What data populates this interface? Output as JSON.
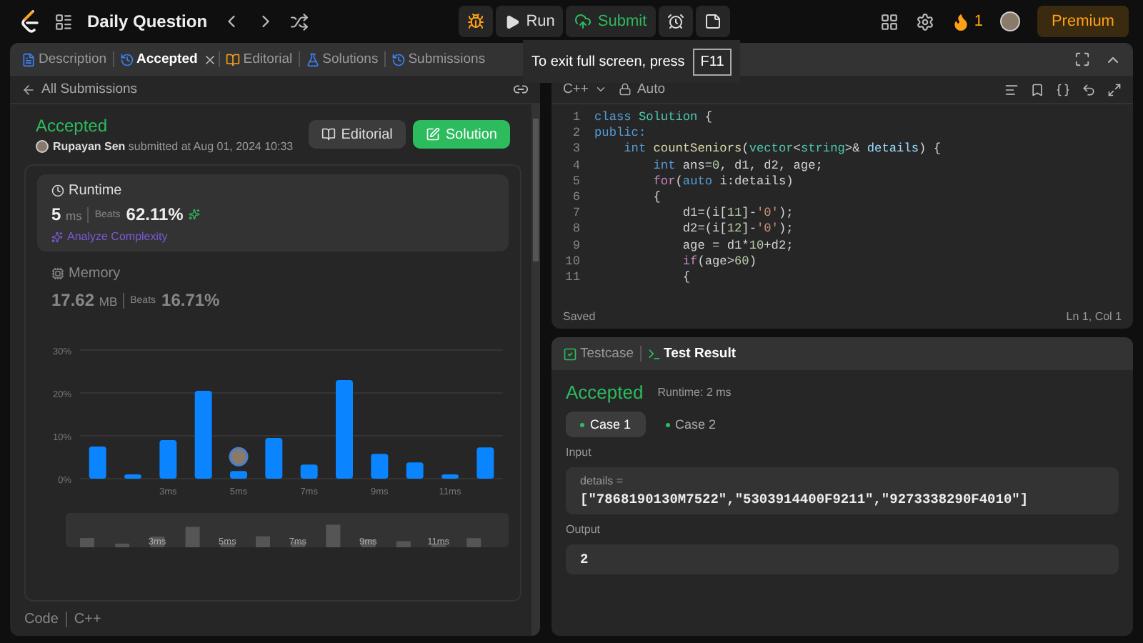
{
  "top_bar": {
    "title": "Daily Question",
    "run": "Run",
    "submit": "Submit",
    "streak": "1",
    "premium": "Premium"
  },
  "fullscreen_tip": {
    "text": "To exit full screen, press",
    "key": "F11"
  },
  "left_tabs": [
    {
      "label": "Description",
      "selected": false,
      "closable": false
    },
    {
      "label": "Accepted",
      "selected": true,
      "closable": true
    },
    {
      "label": "Editorial",
      "selected": false,
      "closable": false
    },
    {
      "label": "Solutions",
      "selected": false,
      "closable": false
    },
    {
      "label": "Submissions",
      "selected": false,
      "closable": false
    }
  ],
  "submission": {
    "back": "All Submissions",
    "status": "Accepted",
    "user": "Rupayan Sen",
    "submitted": "submitted at Aug 01, 2024 10:33",
    "editorial_button": "Editorial",
    "solution_button": "Solution",
    "runtime": {
      "title": "Runtime",
      "value": "5",
      "unit": "ms",
      "beats_label": "Beats",
      "beats": "62.11%",
      "analyze": "Analyze Complexity"
    },
    "memory": {
      "title": "Memory",
      "value": "17.62",
      "unit": "MB",
      "beats_label": "Beats",
      "beats": "16.71%"
    },
    "chart_data": {
      "type": "bar",
      "x": [
        1,
        2,
        3,
        4,
        5,
        6,
        7,
        8,
        9,
        10,
        11,
        12
      ],
      "series": [
        {
          "color": "#0a84ff",
          "values": [
            7.5,
            1,
            9,
            20.5,
            1.8,
            9.5,
            3.3,
            23,
            5.8,
            3.8,
            1,
            7.3
          ]
        }
      ],
      "xlim": [
        0.5,
        12.5
      ],
      "ylim": [
        0,
        30
      ],
      "yticks": [
        {
          "value": 0,
          "label": "0%"
        },
        {
          "value": 10,
          "label": "10%"
        },
        {
          "value": 20,
          "label": "20%"
        },
        {
          "value": 30,
          "label": "30%"
        }
      ],
      "xticks": [
        {
          "value": 3,
          "label": "3ms"
        },
        {
          "value": 5,
          "label": "5ms"
        },
        {
          "value": 7,
          "label": "7ms"
        },
        {
          "value": 9,
          "label": "9ms"
        },
        {
          "value": 11,
          "label": "11ms"
        }
      ]
    },
    "brush_labels": [
      "3ms",
      "5ms",
      "7ms",
      "9ms",
      "11ms"
    ],
    "code_label": "Code",
    "code_language": "C++"
  },
  "editor": {
    "language": "C++",
    "mode": "Auto",
    "status": "Saved",
    "position": "Ln 1, Col 1",
    "lines": [
      {
        "number": "1",
        "tokens": [
          {
            "kind": "kw",
            "text": "class"
          },
          {
            "kind": "type",
            "text": " Solution"
          },
          {
            "kind": "plain",
            "text": " {"
          }
        ]
      },
      {
        "number": "2",
        "tokens": [
          {
            "kind": "kw",
            "text": "public:"
          }
        ]
      },
      {
        "number": "3",
        "tokens": [
          {
            "kind": "kw",
            "text": "    int"
          },
          {
            "kind": "fn",
            "text": " countSeniors"
          },
          {
            "kind": "plain",
            "text": "("
          },
          {
            "kind": "type",
            "text": "vector"
          },
          {
            "kind": "plain",
            "text": "<"
          },
          {
            "kind": "type",
            "text": "string"
          },
          {
            "kind": "plain",
            "text": ">&"
          },
          {
            "kind": "var",
            "text": " details"
          },
          {
            "kind": "plain",
            "text": ") {"
          }
        ]
      },
      {
        "number": "4",
        "tokens": [
          {
            "kind": "kw",
            "text": "        int"
          },
          {
            "kind": "plain",
            "text": " ans="
          },
          {
            "kind": "num",
            "text": "0"
          },
          {
            "kind": "plain",
            "text": ", d1, d2, age;"
          }
        ]
      },
      {
        "number": "5",
        "tokens": [
          {
            "kind": "ctl",
            "text": "        for"
          },
          {
            "kind": "plain",
            "text": "("
          },
          {
            "kind": "kw",
            "text": "auto"
          },
          {
            "kind": "plain",
            "text": " i:details)"
          }
        ]
      },
      {
        "number": "6",
        "tokens": [
          {
            "kind": "plain",
            "text": "        {"
          }
        ]
      },
      {
        "number": "7",
        "tokens": [
          {
            "kind": "plain",
            "text": "            d1=(i["
          },
          {
            "kind": "num",
            "text": "11"
          },
          {
            "kind": "plain",
            "text": "]-"
          },
          {
            "kind": "str",
            "text": "'0'"
          },
          {
            "kind": "plain",
            "text": ");"
          }
        ]
      },
      {
        "number": "8",
        "tokens": [
          {
            "kind": "plain",
            "text": "            d2=(i["
          },
          {
            "kind": "num",
            "text": "12"
          },
          {
            "kind": "plain",
            "text": "]-"
          },
          {
            "kind": "str",
            "text": "'0'"
          },
          {
            "kind": "plain",
            "text": ");"
          }
        ]
      },
      {
        "number": "9",
        "tokens": [
          {
            "kind": "plain",
            "text": "            age = d1*"
          },
          {
            "kind": "num",
            "text": "10"
          },
          {
            "kind": "plain",
            "text": "+d2;"
          }
        ]
      },
      {
        "number": "10",
        "tokens": [
          {
            "kind": "ctl",
            "text": "            if"
          },
          {
            "kind": "plain",
            "text": "(age>"
          },
          {
            "kind": "num",
            "text": "60"
          },
          {
            "kind": "plain",
            "text": ")"
          }
        ]
      },
      {
        "number": "11",
        "tokens": [
          {
            "kind": "plain",
            "text": "            {"
          }
        ]
      }
    ]
  },
  "result_tabs": [
    {
      "label": "Testcase",
      "selected": false
    },
    {
      "label": "Test Result",
      "selected": true
    }
  ],
  "result": {
    "status": "Accepted",
    "runtime": "Runtime: 2 ms",
    "cases": [
      {
        "label": "Case 1",
        "selected": true
      },
      {
        "label": "Case 2",
        "selected": false
      }
    ],
    "input_label": "Input",
    "param": "details =",
    "input_value": "[\"7868190130M7522\",\"5303914400F9211\",\"9273338290F4010\"]",
    "output_label": "Output",
    "output_value": "2"
  }
}
